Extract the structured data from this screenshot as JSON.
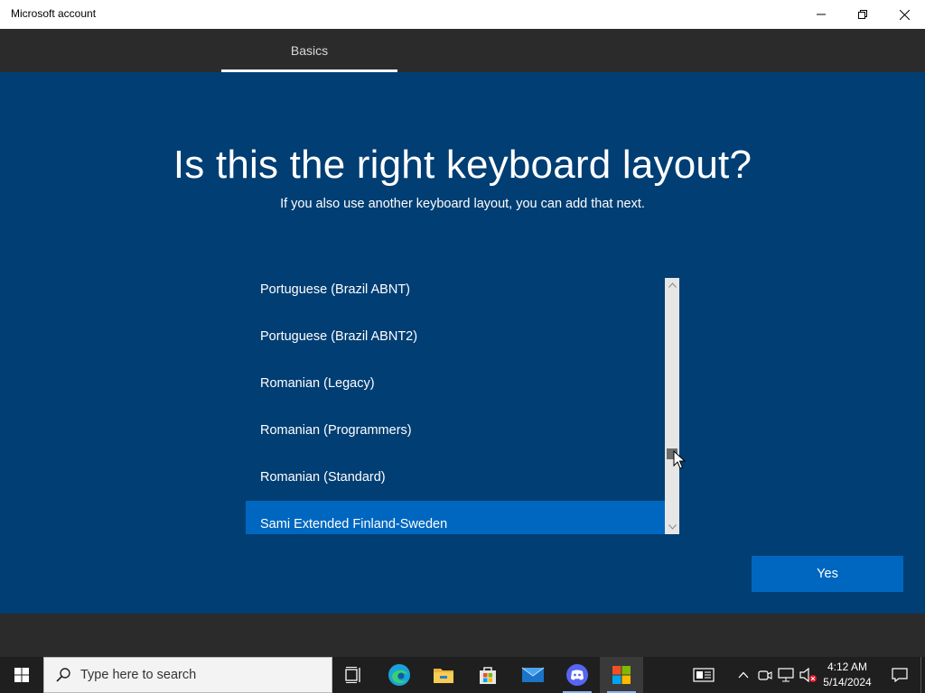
{
  "window": {
    "title": "Microsoft account",
    "controls": {
      "minimize": "minimize-icon",
      "restore": "restore-icon",
      "close": "close-icon"
    }
  },
  "tabs": [
    {
      "label": "Basics",
      "active": true
    }
  ],
  "page": {
    "heading": "Is this the right keyboard layout?",
    "subheading": "If you also use another keyboard layout, you can add that next."
  },
  "layout_list": {
    "items": [
      {
        "label": "Portuguese (Brazil ABNT)",
        "selected": false
      },
      {
        "label": "Portuguese (Brazil ABNT2)",
        "selected": false
      },
      {
        "label": "Romanian (Legacy)",
        "selected": false
      },
      {
        "label": "Romanian (Programmers)",
        "selected": false
      },
      {
        "label": "Romanian (Standard)",
        "selected": false
      },
      {
        "label": "Sami Extended Finland-Sweden",
        "selected": true
      }
    ]
  },
  "buttons": {
    "yes": "Yes"
  },
  "taskbar": {
    "search_placeholder": "Type here to search",
    "apps": [
      "task-view",
      "edge",
      "file-explorer",
      "microsoft-store",
      "mail",
      "discord",
      "windows-setup"
    ],
    "time": "4:12 AM",
    "date": "5/14/2024"
  },
  "colors": {
    "accent": "#0067c0",
    "background": "#003e73",
    "bar": "#2b2b2b",
    "taskbar": "#1f1f1f"
  }
}
